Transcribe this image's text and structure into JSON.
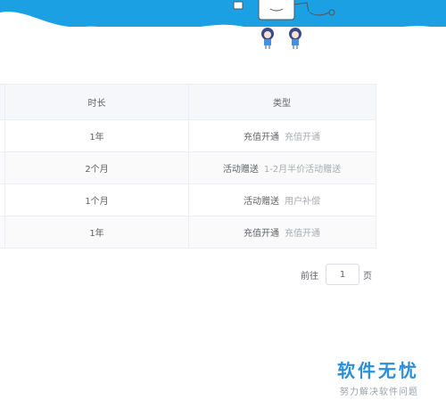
{
  "table": {
    "headers": {
      "duration": "时长",
      "type": "类型"
    },
    "rows": [
      {
        "duration": "1年",
        "type": "充值开通",
        "note": "充值开通"
      },
      {
        "duration": "2个月",
        "type": "活动赠送",
        "note": "1-2月半价活动赠送"
      },
      {
        "duration": "1个月",
        "type": "活动赠送",
        "note": "用户补偿"
      },
      {
        "duration": "1年",
        "type": "充值开通",
        "note": "充值开通"
      }
    ]
  },
  "pager": {
    "prefix": "前往",
    "page": "1",
    "suffix": "页"
  },
  "watermark": {
    "title": "软件无忧",
    "subtitle": "努力解决软件问题"
  },
  "colors": {
    "banner": "#1aa0e3",
    "watermark": "#2e8fd6",
    "header_bg": "#f5f7fa"
  }
}
